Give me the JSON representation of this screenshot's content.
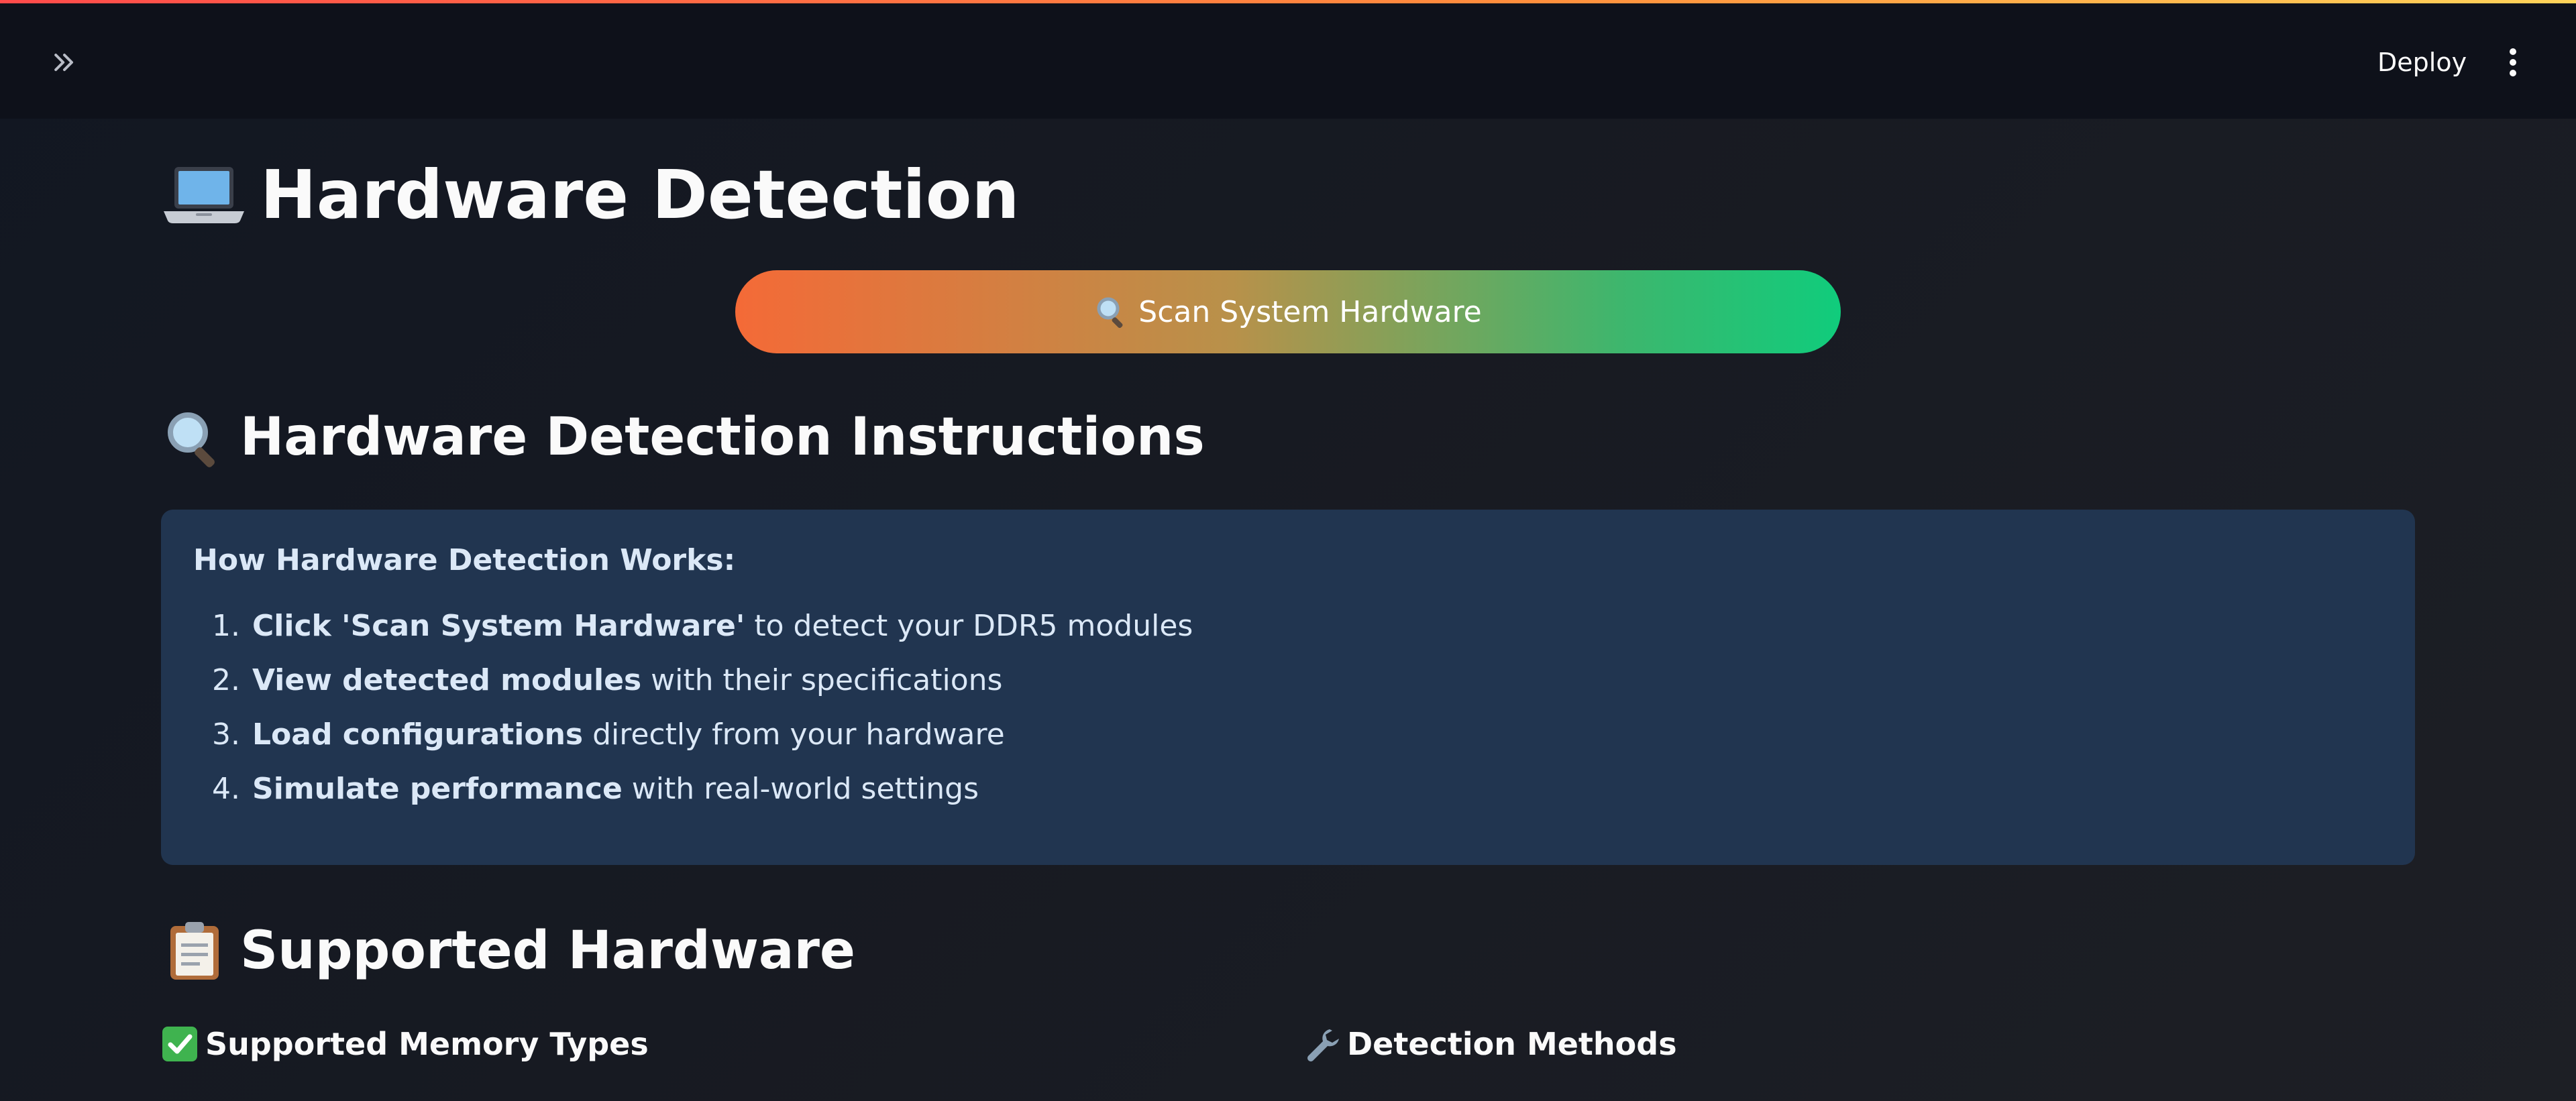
{
  "header": {
    "sidebar_toggle_icon": "double-chevron-right-icon",
    "deploy_label": "Deploy",
    "menu_icon": "vertical-dots-icon"
  },
  "page": {
    "title_icon": "laptop-emoji-icon",
    "title": "Hardware Detection",
    "scan_button": {
      "icon": "magnifier-icon",
      "label": "Scan System Hardware"
    },
    "instructions": {
      "icon": "magnifier-icon",
      "heading": "Hardware Detection Instructions",
      "box_title": "How Hardware Detection Works:",
      "steps": [
        {
          "num": "1.",
          "bold": "Click 'Scan System Hardware'",
          "rest": " to detect your DDR5 modules"
        },
        {
          "num": "2.",
          "bold": "View detected modules",
          "rest": " with their specifications"
        },
        {
          "num": "3.",
          "bold": "Load configurations",
          "rest": " directly from your hardware"
        },
        {
          "num": "4.",
          "bold": "Simulate performance",
          "rest": " with real-world settings"
        }
      ]
    },
    "supported": {
      "icon": "clipboard-icon",
      "heading": "Supported Hardware",
      "memory_types": {
        "icon": "check-mark-button-icon",
        "label": "Supported Memory Types"
      },
      "detection_methods": {
        "icon": "wrench-icon",
        "label": "Detection Methods"
      }
    }
  },
  "colors": {
    "info_box_bg": "#213550",
    "accent_start": "#f46a37",
    "accent_end": "#10cc7c"
  }
}
